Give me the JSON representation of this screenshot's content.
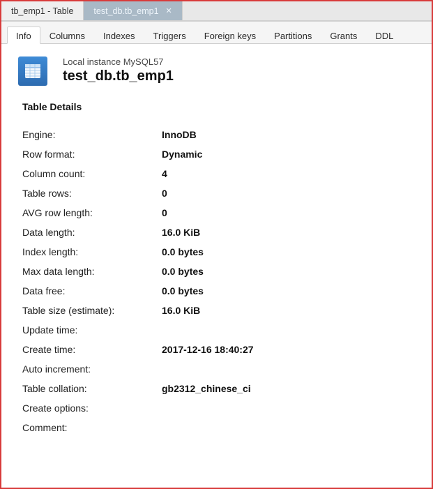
{
  "window_tabs": [
    {
      "label": "tb_emp1 - Table",
      "active": true,
      "closable": false
    },
    {
      "label": "test_db.tb_emp1",
      "active": false,
      "closable": true
    }
  ],
  "inner_tabs": [
    {
      "label": "Info",
      "active": true
    },
    {
      "label": "Columns",
      "active": false
    },
    {
      "label": "Indexes",
      "active": false
    },
    {
      "label": "Triggers",
      "active": false
    },
    {
      "label": "Foreign keys",
      "active": false
    },
    {
      "label": "Partitions",
      "active": false
    },
    {
      "label": "Grants",
      "active": false
    },
    {
      "label": "DDL",
      "active": false
    }
  ],
  "header": {
    "instance": "Local instance MySQL57",
    "object": "test_db.tb_emp1"
  },
  "section_title": "Table Details",
  "details": [
    {
      "label": "Engine:",
      "value": "InnoDB"
    },
    {
      "label": "Row format:",
      "value": "Dynamic"
    },
    {
      "label": "Column count:",
      "value": "4"
    },
    {
      "label": "Table rows:",
      "value": "0"
    },
    {
      "label": "AVG row length:",
      "value": "0"
    },
    {
      "label": "Data length:",
      "value": "16.0 KiB"
    },
    {
      "label": "Index length:",
      "value": "0.0 bytes"
    },
    {
      "label": "Max data length:",
      "value": "0.0 bytes"
    },
    {
      "label": "Data free:",
      "value": "0.0 bytes"
    },
    {
      "label": "Table size (estimate):",
      "value": "16.0 KiB"
    },
    {
      "label": "Update time:",
      "value": ""
    },
    {
      "label": "Create time:",
      "value": "2017-12-16 18:40:27"
    },
    {
      "label": "Auto increment:",
      "value": ""
    },
    {
      "label": "Table collation:",
      "value": "gb2312_chinese_ci"
    },
    {
      "label": "Create options:",
      "value": ""
    },
    {
      "label": "Comment:",
      "value": ""
    }
  ]
}
